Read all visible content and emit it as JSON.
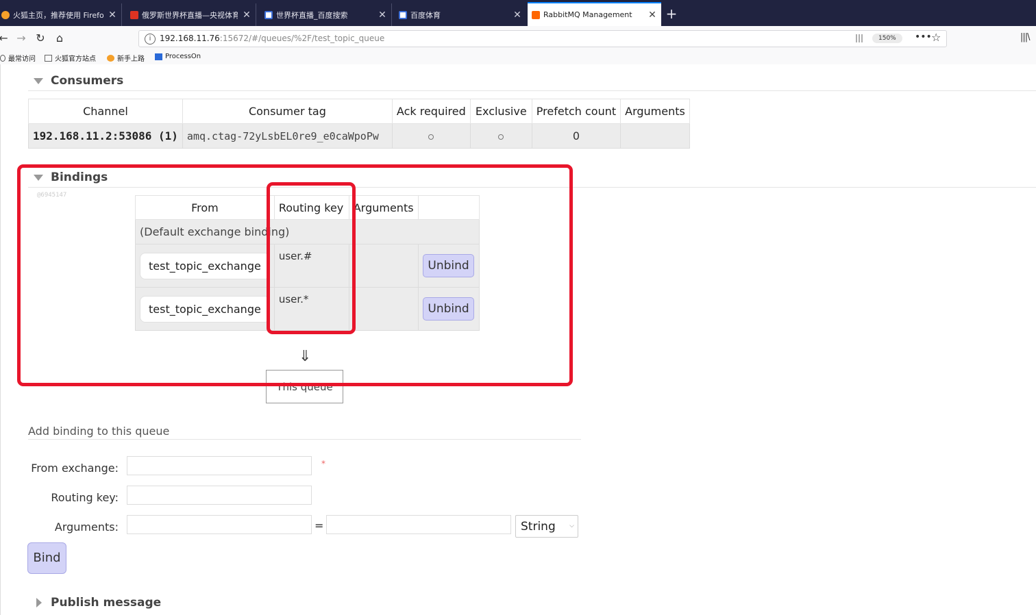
{
  "tabs": [
    {
      "title": "火狐主页，推荐使用 Firefox",
      "icon": "firefox-icon"
    },
    {
      "title": "俄罗斯世界杯直播—央视体育",
      "icon": "cctv-icon"
    },
    {
      "title": "世界杯直播_百度搜索",
      "icon": "baidu-icon"
    },
    {
      "title": "百度体育",
      "icon": "baidu-icon"
    },
    {
      "title": "RabbitMQ Management",
      "icon": "rabbitmq-icon",
      "active": true
    }
  ],
  "url": {
    "host": "192.168.11.76",
    "rest": ":15672/#/queues/%2F/test_topic_queue"
  },
  "zoom": "150%",
  "bookmarks": [
    "最常访问",
    "火狐官方站点",
    "新手上路",
    "ProcessOn"
  ],
  "consumers": {
    "title": "Consumers",
    "headers": [
      "Channel",
      "Consumer tag",
      "Ack required",
      "Exclusive",
      "Prefetch count",
      "Arguments"
    ],
    "row": {
      "channel": "192.168.11.2:53086 (1)",
      "tag": "amq.ctag-72yLsbEL0re9_e0caWpoPw",
      "prefetch": "0",
      "arguments": ""
    }
  },
  "bindings": {
    "title": "Bindings",
    "watermark": "@6945147",
    "headers": [
      "From",
      "Routing key",
      "Arguments",
      ""
    ],
    "default_row": "(Default exchange binding)",
    "rows": [
      {
        "from": "test_topic_exchange",
        "key": "user.#",
        "action": "Unbind"
      },
      {
        "from": "test_topic_exchange",
        "key": "user.*",
        "action": "Unbind"
      }
    ],
    "arrow": "⇓",
    "this_queue": "This queue"
  },
  "add_binding": {
    "title": "Add binding to this queue",
    "from_label": "From exchange:",
    "routing_label": "Routing key:",
    "args_label": "Arguments:",
    "required_mark": "*",
    "eq": "=",
    "type_value": "String",
    "bind_label": "Bind"
  },
  "publish": {
    "title": "Publish message"
  },
  "colors": {
    "highlight": "#e8152b",
    "button": "#d3d3f7",
    "tabbar": "#202340"
  }
}
